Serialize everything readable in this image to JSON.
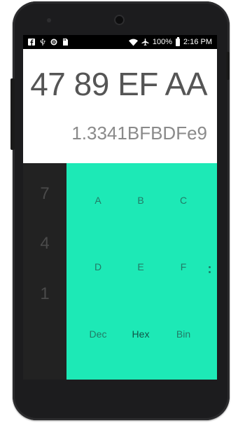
{
  "status_bar": {
    "icons_left": [
      "facebook-icon",
      "usb-icon",
      "sync-icon",
      "sd-card-icon"
    ],
    "battery_percent": "100%",
    "time": "2:16 PM"
  },
  "display": {
    "formula": "47 89 EF AA",
    "result": "1.3341BFBDFe9"
  },
  "numpad": {
    "keys": [
      "7",
      "4",
      "1"
    ]
  },
  "hexpad": {
    "row1": [
      "A",
      "B",
      "C"
    ],
    "row2": [
      "D",
      "E",
      "F"
    ],
    "row3": [
      "Dec",
      "Hex",
      "Bin"
    ]
  },
  "colors": {
    "accent": "#1de9b6",
    "numpad_bg": "#222222",
    "display_bg": "#ffffff"
  }
}
